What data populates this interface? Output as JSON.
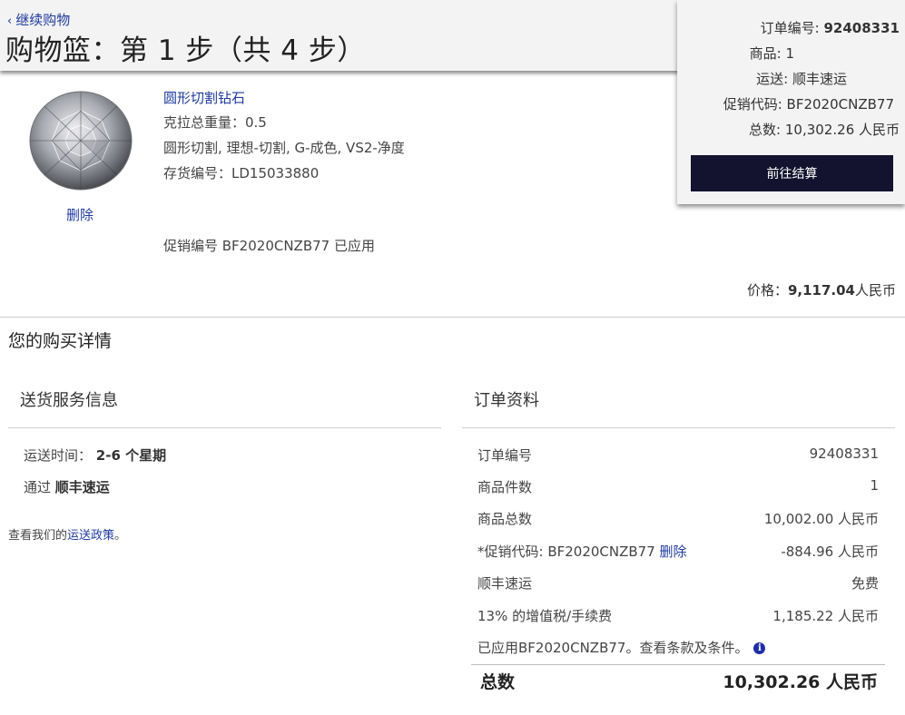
{
  "header": {
    "continue_shopping": "继续购物",
    "title": "购物篮：第 1 步（共 4 步）"
  },
  "summary": {
    "order_no_label": "订单编号:",
    "order_no": "92408331",
    "items_label": "商品:",
    "items": "1",
    "shipping_label": "运送:",
    "shipping": "顺丰速运",
    "promo_label": "促销代码:",
    "promo": "BF2020CNZB77",
    "total_label": "总数:",
    "total": "10,302.26 人民币",
    "checkout_button": "前往结算"
  },
  "item": {
    "title": "圆形切割钻石",
    "carat": "克拉总重量：0.5",
    "specs": "圆形切割, 理想-切割, G-成色, VS2-净度",
    "sku": "存货编号：LD15033880",
    "remove": "删除",
    "promo_applied": "促销编号 BF2020CNZB77 已应用",
    "price_label": "价格：",
    "price_value": "9,117.04",
    "price_currency": "人民币"
  },
  "details": {
    "title": "您的购买详情",
    "shipping_section": {
      "title": "送货服务信息",
      "time_label": "运送时间：",
      "time_value": "2-6 个星期",
      "via_label": "通过",
      "via_value": "顺丰速运",
      "policy_prefix": "查看我们的",
      "policy_link": "运送政策",
      "policy_suffix": "。"
    },
    "order_section": {
      "title": "订单资料",
      "rows": [
        {
          "label": "订单编号",
          "value": "92408331"
        },
        {
          "label": "商品件数",
          "value": "1"
        },
        {
          "label": "商品总数",
          "value": "10,002.00 人民币"
        },
        {
          "label": "顺丰速运",
          "value": "免费"
        },
        {
          "label": "13% 的增值税/手续费",
          "value": "1,185.22 人民币"
        }
      ],
      "promo_label": "*促销代码: BF2020CNZB77",
      "promo_remove": "删除",
      "promo_value": "-884.96 人民币",
      "terms_note": "已应用BF2020CNZB77。查看条款及条件。",
      "info_icon_glyph": "i",
      "total_label": "总数",
      "total_value": "10,302.26 人民币"
    }
  },
  "icons": {
    "chevron": "‹"
  },
  "colors": {
    "link": "#1f3a9e",
    "button_bg": "#13132f",
    "panel_bg": "#f3f3f3"
  }
}
